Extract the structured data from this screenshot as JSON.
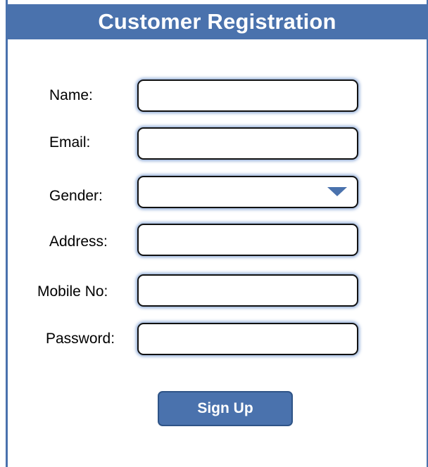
{
  "header": {
    "title": "Customer Registration"
  },
  "form": {
    "name_label": "Name:",
    "name_value": "",
    "email_label": "Email:",
    "email_value": "",
    "gender_label": "Gender:",
    "gender_selected": "",
    "address_label": "Address:",
    "address_value": "",
    "mobile_label": "Mobile No:",
    "mobile_value": "",
    "password_label": "Password:",
    "password_value": "",
    "dropdown_icon": "triangle-down-icon"
  },
  "actions": {
    "signup_label": "Sign Up"
  },
  "colors": {
    "accent": "#4a72ad",
    "field_glow": "#7094cc",
    "field_border": "#111111"
  }
}
